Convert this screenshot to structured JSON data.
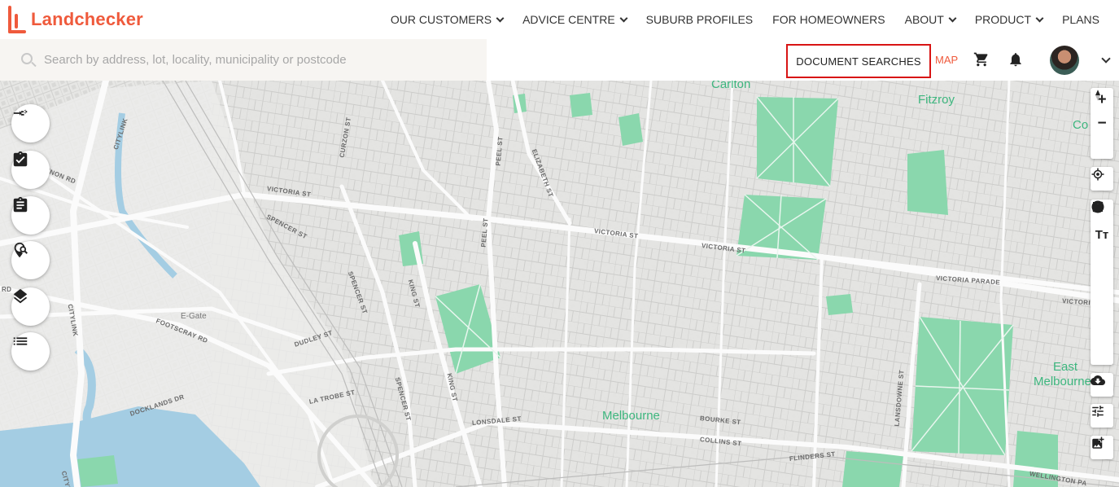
{
  "app": {
    "brand": "Landchecker",
    "colors": {
      "brand": "#ef5a3c",
      "park": "#8ad7ad",
      "water": "#a4cde3",
      "highlight": "#d81414"
    }
  },
  "nav": {
    "items": [
      {
        "label": "OUR CUSTOMERS",
        "has_dropdown": true
      },
      {
        "label": "ADVICE CENTRE",
        "has_dropdown": true
      },
      {
        "label": "SUBURB PROFILES",
        "has_dropdown": false
      },
      {
        "label": "FOR HOMEOWNERS",
        "has_dropdown": false
      },
      {
        "label": "ABOUT",
        "has_dropdown": true
      },
      {
        "label": "PRODUCT",
        "has_dropdown": true
      },
      {
        "label": "PLANS",
        "has_dropdown": false
      }
    ]
  },
  "search": {
    "placeholder": "Search by address, lot, locality, municipality or postcode",
    "value": "",
    "icon": "search-icon"
  },
  "toolbar": {
    "document_searches": "DOCUMENT SEARCHES",
    "map_link": "MAP",
    "cart_icon": "cart-icon",
    "notifications_icon": "bell-icon",
    "avatar": "user-avatar"
  },
  "map": {
    "suburbs": {
      "carlton": "Carlton",
      "fitzroy": "Fitzroy",
      "collingwood": "Co",
      "east_melbourne_1": "East",
      "east_melbourne_2": "Melbourne",
      "melbourne": "Melbourne"
    },
    "places": {
      "egate": "E-Gate"
    },
    "streets": {
      "victoria_st_w": "VICTORIA ST",
      "victoria_st_c": "VICTORIA ST",
      "victoria_st_e": "VICTORIA ST",
      "victoria_parade": "VICTORIA PARADE",
      "victoria_e": "VICTORIA",
      "spencer_st_n": "SPENCER ST",
      "spencer_st_c": "SPENCER ST",
      "spencer_st_s": "SPENCER ST",
      "king_st_n": "KING ST",
      "king_st_s": "KING ST",
      "peel_st_a": "PEEL ST",
      "peel_st_b": "PEEL ST",
      "elizabeth_st": "ELIZABETH ST",
      "curzon_st": "CURZON ST",
      "dudley_st": "DUDLEY ST",
      "footscray_rd": "FOOTSCRAY RD",
      "flinders_st": "FLINDERS ST",
      "lansdowne_st": "LANSDOWNE ST",
      "wellington_pa": "WELLINGTON PA",
      "citylink_n": "CITYLINK",
      "citylink_s": "CITYLINK",
      "citylink_w": "CITYLINK",
      "dynon_rd": "YNON RD",
      "rd": "RD",
      "la_trobe_st": "LA TROBE ST",
      "lonsdale_st": "LONSDALE ST",
      "collins_st": "COLLINS ST",
      "bourke_st": "BOURKE ST",
      "docklands": "DOCKLANDS DR"
    }
  },
  "left_tools": [
    {
      "icon": "compare-icon"
    },
    {
      "icon": "checklist-icon"
    },
    {
      "icon": "clipboard-icon"
    },
    {
      "icon": "map-search-icon"
    },
    {
      "icon": "layers-icon"
    },
    {
      "icon": "list-icon"
    }
  ],
  "right_tools": [
    {
      "icon": "zoom-in-icon",
      "glyph": "+"
    },
    {
      "icon": "zoom-out-icon",
      "glyph": "−"
    },
    {
      "icon": "compass-icon"
    },
    {
      "icon": "locate-icon"
    },
    {
      "icon": "info-icon"
    },
    {
      "icon": "text-tool-icon",
      "glyph": "Tт"
    },
    {
      "icon": "line-tool-icon"
    },
    {
      "icon": "polygon-tool-icon"
    },
    {
      "icon": "rectangle-tool-icon"
    },
    {
      "icon": "circle-tool-icon"
    },
    {
      "icon": "delete-icon"
    },
    {
      "icon": "download-icon"
    },
    {
      "icon": "filter-sliders-icon"
    },
    {
      "icon": "add-image-icon"
    }
  ]
}
